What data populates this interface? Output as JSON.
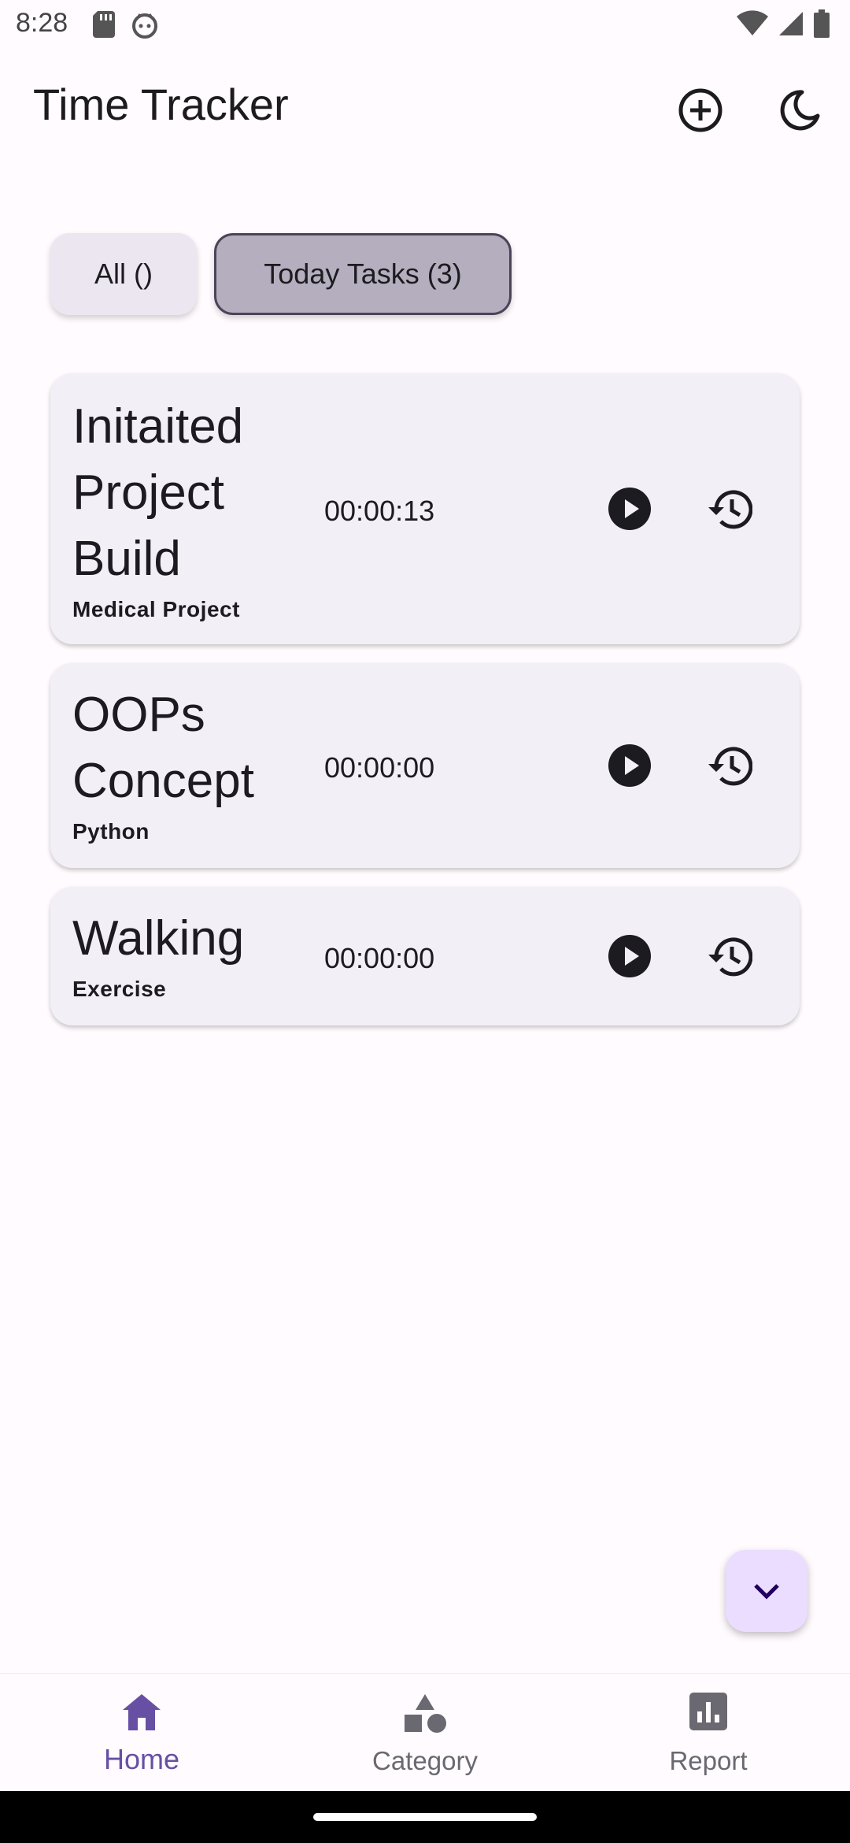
{
  "status": {
    "time": "8:28"
  },
  "app": {
    "title": "Time Tracker"
  },
  "filters": {
    "all_label": "All ()",
    "today_label": "Today Tasks (3)"
  },
  "tasks": [
    {
      "title": "Initaited Project Build",
      "category": "Medical Project",
      "time": "00:00:13"
    },
    {
      "title": "OOPs Concept",
      "category": "Python",
      "time": "00:00:00"
    },
    {
      "title": "Walking",
      "category": "Exercise",
      "time": "00:00:00"
    }
  ],
  "nav": {
    "items": [
      {
        "label": "Home",
        "icon": "home-icon",
        "active": true
      },
      {
        "label": "Category",
        "icon": "category-icon",
        "active": false
      },
      {
        "label": "Report",
        "icon": "report-icon",
        "active": false
      }
    ]
  },
  "colors": {
    "accent": "#6750A4",
    "card": "#F3EFF7",
    "fab": "#EADDFF",
    "chip_selected": "#B5AEBE"
  }
}
